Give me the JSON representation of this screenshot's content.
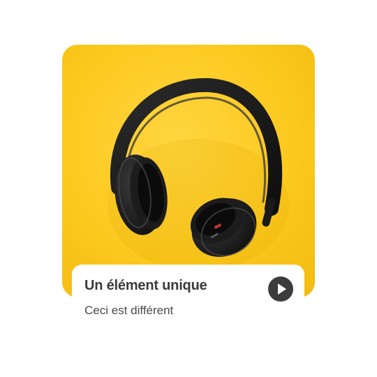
{
  "card": {
    "title": "Un élément unique",
    "subtitle": "Ceci est différent",
    "media_icon": "headphones-image",
    "action_icon": "play-icon"
  },
  "colors": {
    "media_background": "#fcc91f",
    "play_button": "#3c3c3c",
    "title_text": "#3a3a3a",
    "subtitle_text": "#4a4a4a"
  }
}
